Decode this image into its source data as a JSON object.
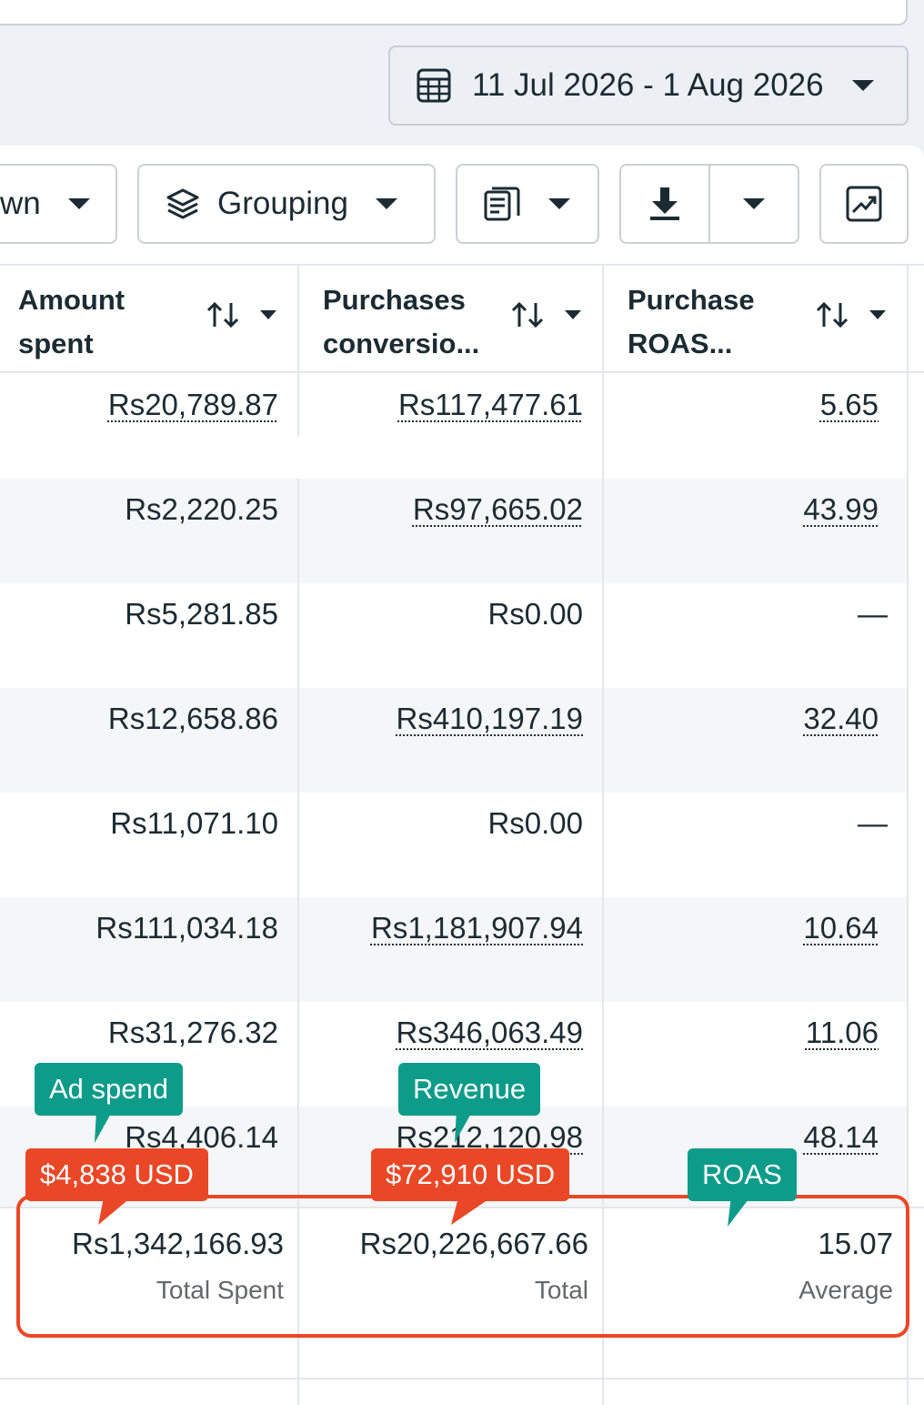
{
  "header": {
    "date_range": "11 Jul 2026 - 1 Aug 2026"
  },
  "toolbar": {
    "breakdown_label": "wn",
    "grouping_label": "Grouping"
  },
  "table": {
    "columns": [
      {
        "line1": "Amount",
        "line2": "spent"
      },
      {
        "line1": "Purchases",
        "line2": "conversio..."
      },
      {
        "line1": "Purchase",
        "line2": "ROAS..."
      }
    ],
    "rows": [
      [
        "Rs20,789.87",
        "Rs117,477.61",
        "5.65"
      ],
      [
        "Rs2,220.25",
        "Rs97,665.02",
        "43.99"
      ],
      [
        "Rs5,281.85",
        "Rs0.00",
        "—"
      ],
      [
        "Rs12,658.86",
        "Rs410,197.19",
        "32.40"
      ],
      [
        "Rs11,071.10",
        "Rs0.00",
        "—"
      ],
      [
        "Rs111,034.18",
        "Rs1,181,907.94",
        "10.64"
      ],
      [
        "Rs31,276.32",
        "Rs346,063.49",
        "11.06"
      ],
      [
        "Rs4,406.14",
        "Rs212,120.98",
        "48.14"
      ]
    ],
    "totals": {
      "spent": "Rs1,342,166.93",
      "spent_label": "Total Spent",
      "revenue": "Rs20,226,667.66",
      "revenue_label": "Total",
      "roas": "15.07",
      "roas_label": "Average"
    }
  },
  "annotations": {
    "ad_spend": "Ad spend",
    "revenue": "Revenue",
    "roas": "ROAS",
    "spend_usd": "$4,838 USD",
    "revenue_usd": "$72,910 USD"
  },
  "colors": {
    "highlight": "#ea4726",
    "tag_green": "#0d9c8a"
  }
}
